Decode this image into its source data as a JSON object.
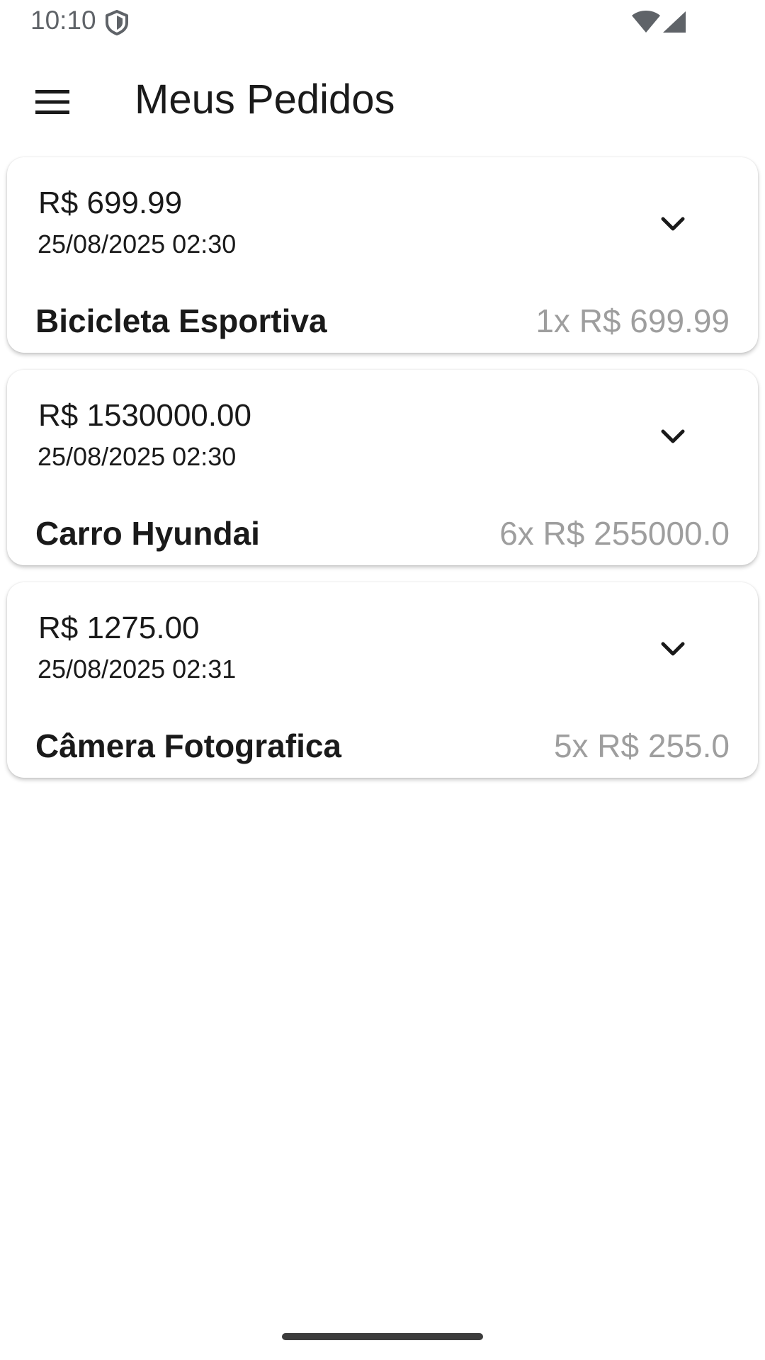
{
  "status_bar": {
    "time": "10:10",
    "icons": [
      "shield-icon",
      "wifi-icon",
      "signal-icon"
    ]
  },
  "app_bar": {
    "title": "Meus Pedidos",
    "menu_icon": "hamburger-menu-icon"
  },
  "orders": [
    {
      "total": "R$ 699.99",
      "date": "25/08/2025 02:30",
      "item_name": "Bicicleta Esportiva",
      "item_qty_price": "1x R$ 699.99"
    },
    {
      "total": "R$ 1530000.00",
      "date": "25/08/2025 02:30",
      "item_name": "Carro Hyundai",
      "item_qty_price": "6x R$ 255000.0"
    },
    {
      "total": "R$ 1275.00",
      "date": "25/08/2025 02:31",
      "item_name": "Câmera Fotografica",
      "item_qty_price": "5x R$ 255.0"
    }
  ],
  "colors": {
    "text_primary": "#1a1a1a",
    "text_secondary": "#9e9e9e",
    "status_text": "#5f6368",
    "background": "#ffffff"
  }
}
